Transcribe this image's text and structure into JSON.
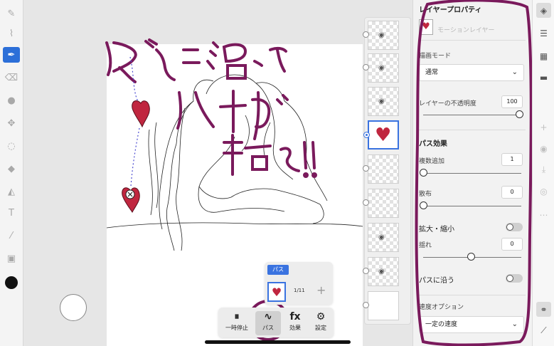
{
  "colors": {
    "accent": "#3a73e0",
    "marker": "#7a1a5c",
    "heart": "#c0263f",
    "current_color": "#111111"
  },
  "toolbar": {
    "tools": [
      {
        "name": "pencil-icon",
        "glyph": "✎"
      },
      {
        "name": "brush-icon",
        "glyph": "🖌"
      },
      {
        "name": "vector-brush-icon",
        "glyph": "✒"
      },
      {
        "name": "eraser-icon",
        "glyph": "⌫"
      },
      {
        "name": "blend-icon",
        "glyph": "●"
      },
      {
        "name": "move-icon",
        "glyph": "✥"
      },
      {
        "name": "lasso-icon",
        "glyph": "◌"
      },
      {
        "name": "fill-icon",
        "glyph": "◆"
      },
      {
        "name": "shape-icon",
        "glyph": "◭"
      },
      {
        "name": "text-icon",
        "glyph": "T"
      },
      {
        "name": "eyedropper-icon",
        "glyph": "⁄"
      },
      {
        "name": "image-icon",
        "glyph": "▣"
      }
    ]
  },
  "annotation": {
    "line1": "パスに沿って",
    "line2": "ハートが",
    "line3": "動く!!"
  },
  "path_popup": {
    "tab_label": "パス",
    "count": "1/11",
    "add": "+"
  },
  "bottom_bar": {
    "items": [
      {
        "name": "pause-button",
        "icon": "⏸",
        "label": "一時停止"
      },
      {
        "name": "path-button",
        "icon": "∿",
        "label": "パス"
      },
      {
        "name": "effects-button",
        "icon": "fx",
        "label": "効果"
      },
      {
        "name": "settings-button",
        "icon": "⚙",
        "label": "設定"
      }
    ]
  },
  "panel": {
    "title": "レイヤープロパティ",
    "name_placeholder": "モーションレイヤー",
    "blend_mode_label": "描画モード",
    "blend_mode_value": "通常",
    "opacity_label": "レイヤーの不透明度",
    "opacity_value": "100",
    "path_effect_heading": "パス効果",
    "duplicate_label": "複数追加",
    "duplicate_value": "1",
    "scatter_label": "散布",
    "scatter_value": "0",
    "scale_label": "拡大・縮小",
    "sway_label": "揺れ",
    "sway_value": "0",
    "follow_path_label": "パスに沿う",
    "speed_option_label": "速度オプション",
    "speed_option_value": "一定の速度"
  },
  "right_icons": [
    {
      "name": "layers-icon",
      "glyph": "◈"
    },
    {
      "name": "adjustments-icon",
      "glyph": "☰"
    },
    {
      "name": "grid-icon",
      "glyph": "▦"
    },
    {
      "name": "comment-icon",
      "glyph": "▬"
    },
    {
      "name": "add-layer-icon",
      "glyph": "+"
    },
    {
      "name": "visibility-icon",
      "glyph": "◉"
    },
    {
      "name": "import-icon",
      "glyph": "⤓"
    },
    {
      "name": "mask-icon",
      "glyph": "◎"
    },
    {
      "name": "more-icon",
      "glyph": "…"
    },
    {
      "name": "motion-icon",
      "glyph": "⚭"
    },
    {
      "name": "ruler-icon",
      "glyph": "⟋"
    }
  ]
}
